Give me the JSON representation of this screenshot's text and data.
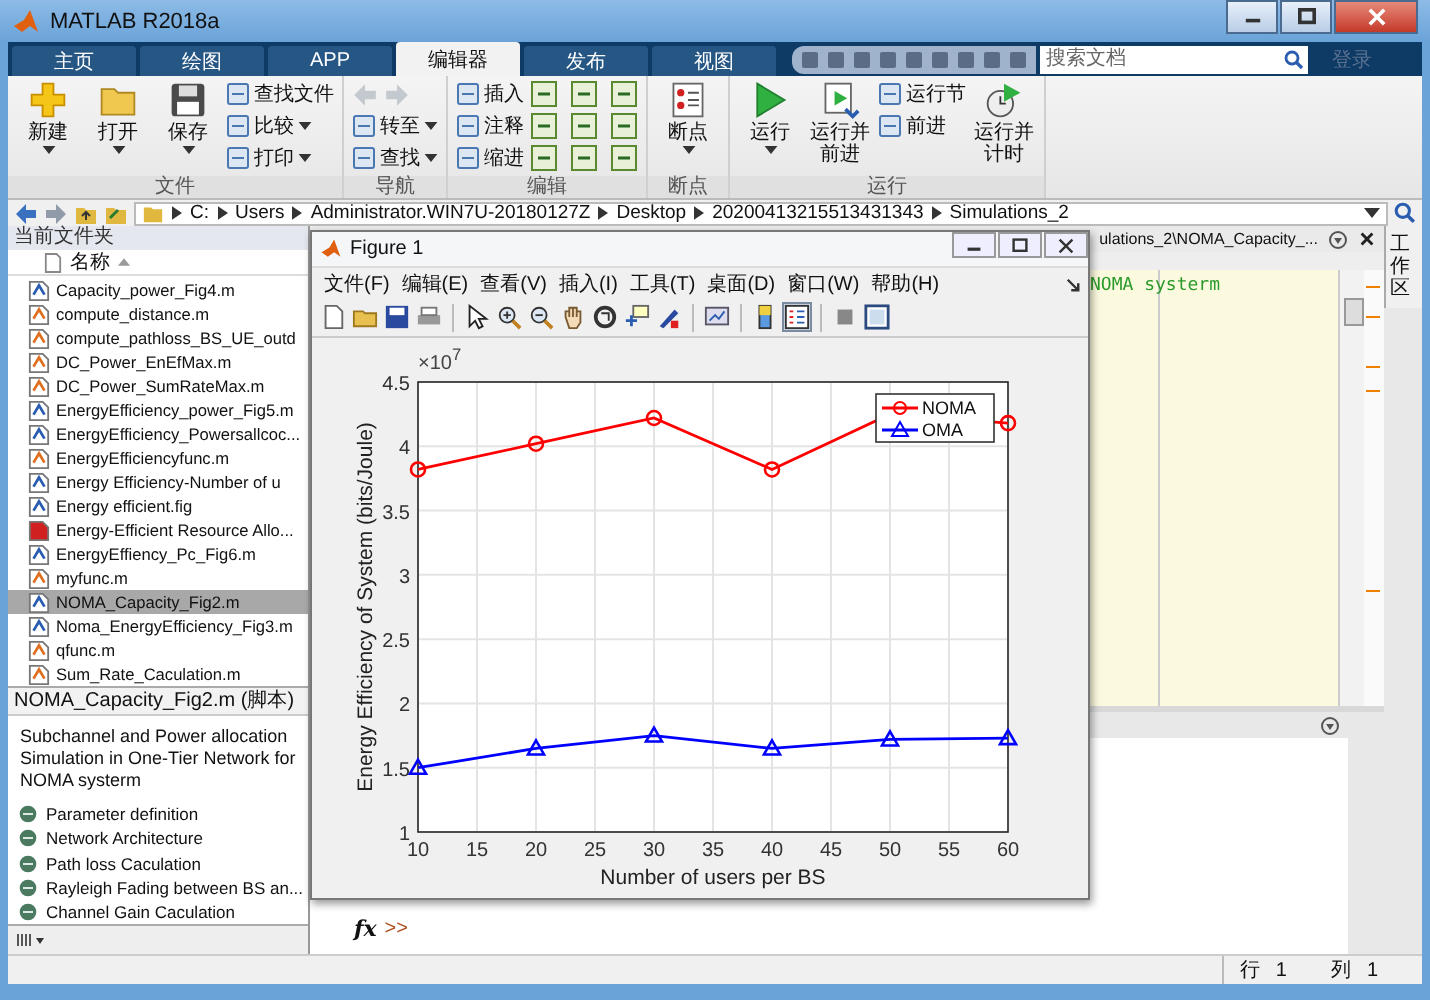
{
  "window": {
    "title": "MATLAB R2018a"
  },
  "tabs": [
    {
      "label": "主页",
      "selected": false
    },
    {
      "label": "绘图",
      "selected": false
    },
    {
      "label": "APP",
      "selected": false
    },
    {
      "label": "编辑器",
      "selected": true
    },
    {
      "label": "发布",
      "selected": false
    },
    {
      "label": "视图",
      "selected": false
    }
  ],
  "search": {
    "placeholder": "搜索文档"
  },
  "login": "登录",
  "ribbon": [
    {
      "title": "文件",
      "columns": [
        {
          "kind": "large",
          "lines": [
            "新建"
          ],
          "dropdown": true
        },
        {
          "kind": "large",
          "lines": [
            "打开"
          ],
          "dropdown": true
        },
        {
          "kind": "large",
          "lines": [
            "保存"
          ],
          "dropdown": true
        },
        {
          "kind": "stack",
          "items": [
            {
              "kind": "button",
              "label": "查找文件",
              "dropdown": false
            },
            {
              "kind": "button",
              "label": "比较",
              "dropdown": true
            },
            {
              "kind": "button",
              "label": "打印",
              "dropdown": true
            }
          ]
        }
      ]
    },
    {
      "title": "导航",
      "columns": [
        {
          "kind": "stack",
          "items": [
            {
              "kind": "arrows"
            },
            {
              "kind": "button",
              "label": "转至",
              "dropdown": true
            },
            {
              "kind": "button",
              "label": "查找",
              "dropdown": true
            }
          ]
        }
      ]
    },
    {
      "title": "编辑",
      "columns": [
        {
          "kind": "stack",
          "items": [
            {
              "kind": "button",
              "label": "插入",
              "dropdown": false
            },
            {
              "kind": "button",
              "label": "注释",
              "dropdown": false
            },
            {
              "kind": "button",
              "label": "缩进",
              "dropdown": false
            }
          ]
        },
        {
          "kind": "grid"
        }
      ]
    },
    {
      "title": "断点",
      "columns": [
        {
          "kind": "large",
          "lines": [
            "断点"
          ],
          "dropdown": true
        }
      ]
    },
    {
      "title": "运行",
      "columns": [
        {
          "kind": "large",
          "lines": [
            "运行"
          ],
          "dropdown": true
        },
        {
          "kind": "large",
          "lines": [
            "运行并",
            "前进"
          ],
          "dropdown": false
        },
        {
          "kind": "stack",
          "items": [
            {
              "kind": "button",
              "label": "运行节",
              "dropdown": false
            },
            {
              "kind": "button",
              "label": "前进",
              "dropdown": false
            }
          ]
        },
        {
          "kind": "large",
          "lines": [
            "运行并",
            "计时"
          ],
          "dropdown": false
        }
      ]
    }
  ],
  "address": [
    "C:",
    "Users",
    "Administrator.WIN7U-20180127Z",
    "Desktop",
    "20200413215513431343",
    "Simulations_2"
  ],
  "folder": {
    "title": "当前文件夹",
    "column": "名称",
    "files": [
      {
        "name": "Capacity_power_Fig4.m",
        "kind": "script",
        "selected": false
      },
      {
        "name": "compute_distance.m",
        "kind": "function",
        "selected": false
      },
      {
        "name": "compute_pathloss_BS_UE_outd",
        "kind": "function",
        "selected": false
      },
      {
        "name": "DC_Power_EnEfMax.m",
        "kind": "function",
        "selected": false
      },
      {
        "name": "DC_Power_SumRateMax.m",
        "kind": "function",
        "selected": false
      },
      {
        "name": "EnergyEfficiency_power_Fig5.m",
        "kind": "script",
        "selected": false
      },
      {
        "name": "EnergyEfficiency_Powersallcoc...",
        "kind": "script",
        "selected": false
      },
      {
        "name": "EnergyEfficiencyfunc.m",
        "kind": "function",
        "selected": false
      },
      {
        "name": "Energy Efficiency-Number of u",
        "kind": "script",
        "selected": false
      },
      {
        "name": "Energy efficient.fig",
        "kind": "script",
        "selected": false
      },
      {
        "name": "Energy-Efficient Resource Allo...",
        "kind": "pdf",
        "selected": false
      },
      {
        "name": "EnergyEffiency_Pc_Fig6.m",
        "kind": "script",
        "selected": false
      },
      {
        "name": "myfunc.m",
        "kind": "function",
        "selected": false
      },
      {
        "name": "NOMA_Capacity_Fig2.m",
        "kind": "script",
        "selected": true
      },
      {
        "name": "Noma_EnergyEfficiency_Fig3.m",
        "kind": "script",
        "selected": false
      },
      {
        "name": "qfunc.m",
        "kind": "function",
        "selected": false
      },
      {
        "name": "Sum_Rate_Caculation.m",
        "kind": "function",
        "selected": false
      }
    ]
  },
  "details": {
    "title": "NOMA_Capacity_Fig2.m (脚本)",
    "description": "Subchannel and Power allocation Simulation in One-Tier Network for NOMA systerm",
    "sections": [
      "Parameter definition",
      "Network Architecture",
      "Path loss Caculation",
      "Rayleigh Fading between BS an...",
      "Channel Gain Caculation"
    ]
  },
  "editor": {
    "path": "ulations_2\\NOMA_Capacity_...",
    "lines": [
      "NOMA systerm"
    ]
  },
  "side_tab": "工作区",
  "command": {
    "fx": "fx",
    "prompt": ">>"
  },
  "status": {
    "row_label": "行",
    "row": "1",
    "col_label": "列",
    "col": "1"
  },
  "figure": {
    "title": "Figure 1",
    "menus": [
      "文件(F)",
      "编辑(E)",
      "查看(V)",
      "插入(I)",
      "工具(T)",
      "桌面(D)",
      "窗口(W)",
      "帮助(H)"
    ],
    "chart_data": {
      "type": "line",
      "xlabel": "Number of users per BS",
      "ylabel": "Energy Efficiency of System (bits/Joule)",
      "x": [
        10,
        20,
        30,
        40,
        50,
        60
      ],
      "xlim": [
        10,
        60
      ],
      "ylim": [
        1,
        4.5
      ],
      "xticks": [
        10,
        15,
        20,
        25,
        30,
        35,
        40,
        45,
        50,
        55,
        60
      ],
      "yticks": [
        1,
        1.5,
        2,
        2.5,
        3,
        3.5,
        4,
        4.5
      ],
      "annotations": [
        "×10$^{7}$"
      ],
      "grid": true,
      "legend": true,
      "series": [
        {
          "name": "NOMA",
          "color": "#ff0000",
          "marker": "circle",
          "values": [
            3.82,
            4.02,
            4.22,
            3.82,
            4.25,
            4.18
          ]
        },
        {
          "name": "OMA",
          "color": "#0000ff",
          "marker": "triangle",
          "values": [
            1.5,
            1.65,
            1.75,
            1.65,
            1.72,
            1.73
          ]
        }
      ]
    }
  }
}
